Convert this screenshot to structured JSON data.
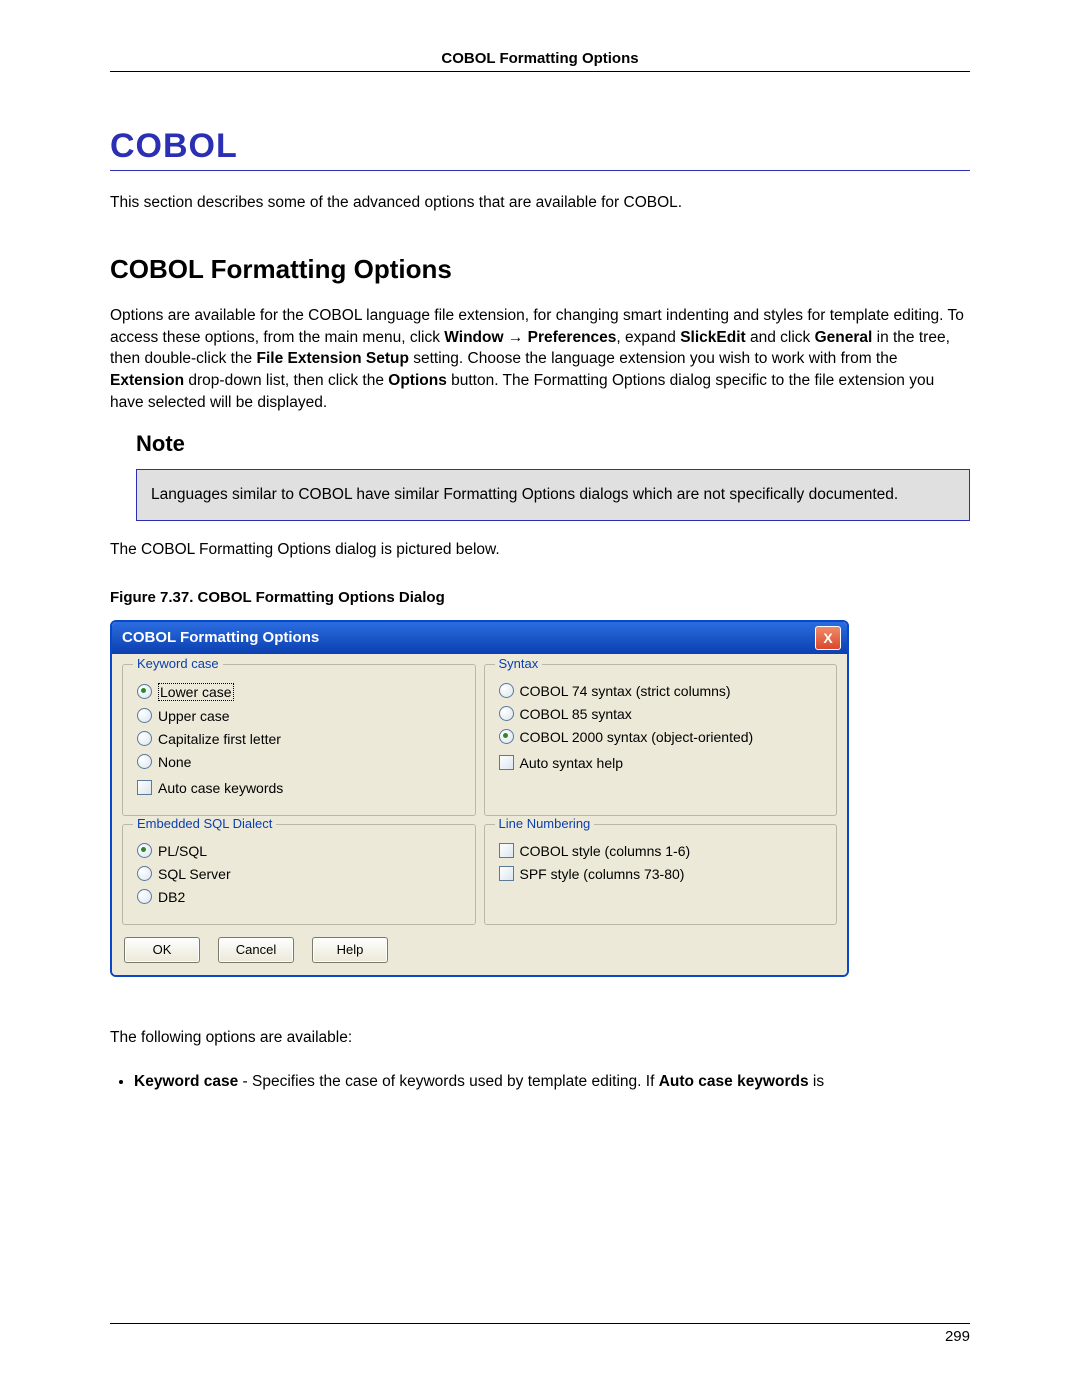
{
  "header": "COBOL Formatting Options",
  "title": "COBOL",
  "intro": "This section describes some of the advanced options that are available for COBOL.",
  "section_title": "COBOL Formatting Options",
  "para_pre": "Options are available for the COBOL language file extension, for changing smart indenting and styles for template editing. To access these options, from the main menu, click ",
  "b_window": "Window",
  "arrow": " → ",
  "b_prefs": "Preferences",
  "para_mid1": ", expand ",
  "b_slickedit": "SlickEdit",
  "para_mid2": " and click ",
  "b_general": "General",
  "para_mid3": " in the tree, then double-click the ",
  "b_fes": "File Extension Setup",
  "para_mid4": " setting. Choose the language extension you wish to work with from the ",
  "b_ext": "Extension",
  "para_mid5": " drop-down list, then click the ",
  "b_options": "Options",
  "para_end": " button. The Formatting Options dialog specific to the file extension you have selected will be displayed.",
  "note_title": "Note",
  "note_text": "Languages similar to COBOL have similar Formatting Options dialogs which are not specifically documented.",
  "below_text": "The COBOL Formatting Options dialog is pictured below.",
  "figure_caption": "Figure 7.37. COBOL Formatting Options Dialog",
  "dialog": {
    "title": "COBOL Formatting Options",
    "close": "X",
    "groups": {
      "keyword_case": {
        "legend": "Keyword case",
        "opts": [
          "Lower case",
          "Upper case",
          "Capitalize first letter",
          "None"
        ],
        "selected": 0,
        "check": "Auto case keywords"
      },
      "syntax": {
        "legend": "Syntax",
        "opts": [
          "COBOL 74 syntax (strict columns)",
          "COBOL 85 syntax",
          "COBOL 2000 syntax (object-oriented)"
        ],
        "selected": 2,
        "check": "Auto syntax help"
      },
      "sql": {
        "legend": "Embedded SQL Dialect",
        "opts": [
          "PL/SQL",
          "SQL Server",
          "DB2"
        ],
        "selected": 0
      },
      "lineno": {
        "legend": "Line Numbering",
        "checks": [
          "COBOL style (columns 1-6)",
          "SPF style (columns 73-80)"
        ]
      }
    },
    "buttons": {
      "ok": "OK",
      "cancel": "Cancel",
      "help": "Help"
    }
  },
  "following": "The following options are available:",
  "bullet_b1": "Keyword case",
  "bullet_mid": " - Specifies the case of keywords used by template editing. If ",
  "bullet_b2": "Auto case keywords",
  "bullet_end": " is",
  "page_number": "299"
}
